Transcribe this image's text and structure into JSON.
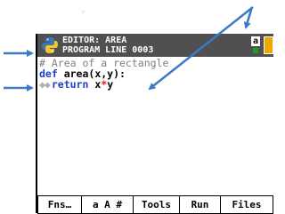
{
  "titlebar": {
    "editor_title": "EDITOR: AREA",
    "program_line": "PROGRAM LINE 0003",
    "mode_badge": "a"
  },
  "code": {
    "line1": "# Area of a rectangle",
    "line2_kw": "def",
    "line2_rest": " area(x,y):",
    "line3_indent": "◆◆",
    "line3_kw": "return",
    "line3_a": " x",
    "line3_op": "*",
    "line3_b": "y"
  },
  "softkeys": [
    "Fns…",
    "a A #",
    "Tools",
    "Run",
    "Files"
  ],
  "colors": {
    "titlebar": "#505050",
    "keyword": "#1f41c8",
    "comment": "#7f7f7f",
    "operator": "#e21f1f",
    "arrow": "#3a7cc4",
    "battery": "#f0a800",
    "mode_dot": "#1f9a2d"
  }
}
